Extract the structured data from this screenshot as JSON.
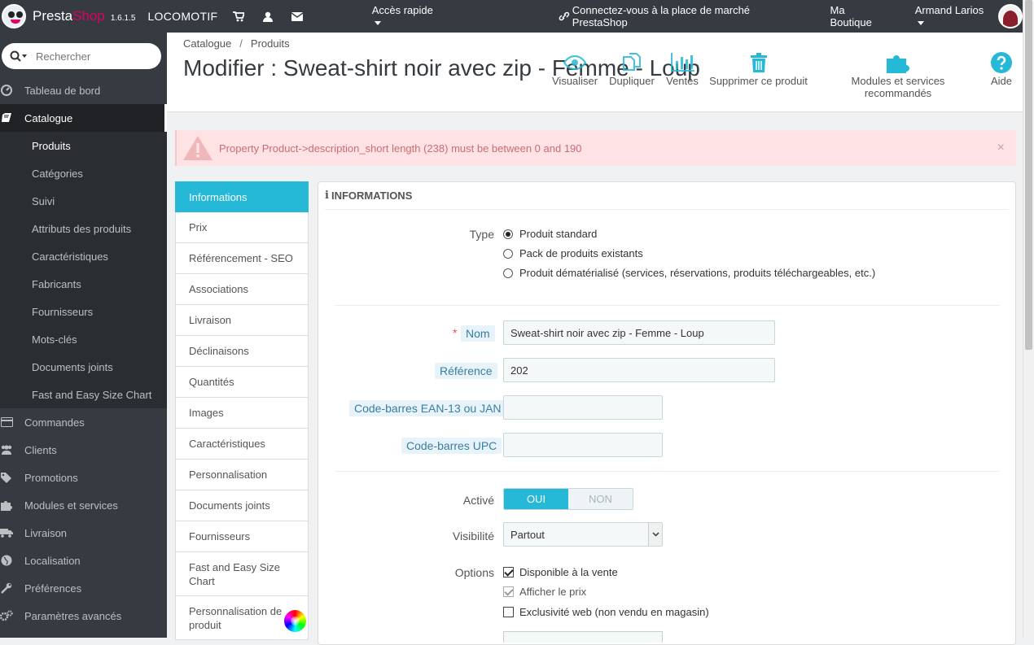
{
  "topbar": {
    "logo_presta": "Presta",
    "logo_shop": "Shop",
    "version": "1.6.1.5",
    "shop_name": "LOCOMOTIF",
    "quick_access": "Accès rapide",
    "marketplace": "Connectez-vous à la place de marché PrestaShop",
    "my_shop": "Ma Boutique",
    "user": "Armand Larios"
  },
  "sidebar": {
    "search_placeholder": "Rechercher",
    "items": [
      {
        "label": "Tableau de bord",
        "icon": "dashboard-icon"
      },
      {
        "label": "Catalogue",
        "icon": "book-icon"
      },
      {
        "label": "Commandes",
        "icon": "credit-card-icon"
      },
      {
        "label": "Clients",
        "icon": "users-icon"
      },
      {
        "label": "Promotions",
        "icon": "tags-icon"
      },
      {
        "label": "Modules et services",
        "icon": "puzzle-icon"
      },
      {
        "label": "Livraison",
        "icon": "truck-icon"
      },
      {
        "label": "Localisation",
        "icon": "globe-icon"
      },
      {
        "label": "Préférences",
        "icon": "wrench-icon"
      },
      {
        "label": "Paramètres avancés",
        "icon": "cogs-icon"
      }
    ],
    "catalogue_sub": [
      "Produits",
      "Catégories",
      "Suivi",
      "Attributs des produits",
      "Caractéristiques",
      "Fabricants",
      "Fournisseurs",
      "Mots-clés",
      "Documents joints",
      "Fast and Easy Size Chart"
    ]
  },
  "header": {
    "breadcrumb": [
      "Catalogue",
      "Produits"
    ],
    "title": "Modifier : Sweat-shirt noir avec zip - Femme - Loup",
    "toolbar": {
      "view": "Visualiser",
      "duplicate": "Dupliquer",
      "sales": "Ventes",
      "delete": "Supprimer ce produit",
      "modules": "Modules et services recommandés",
      "help": "Aide"
    }
  },
  "alert": {
    "message": "Property Product->description_short length (238) must be between 0 and 190",
    "close": "×"
  },
  "tabs": [
    "Informations",
    "Prix",
    "Référencement - SEO",
    "Associations",
    "Livraison",
    "Déclinaisons",
    "Quantités",
    "Images",
    "Caractéristiques",
    "Personnalisation",
    "Documents joints",
    "Fournisseurs",
    "Fast and Easy Size Chart",
    "Personnalisation de produit"
  ],
  "panel": {
    "heading": "INFORMATIONS",
    "type_label": "Type",
    "type_options": [
      "Produit standard",
      "Pack de produits existants",
      "Produit dématérialisé (services, réservations, produits téléchargeables, etc.)"
    ],
    "required_mark": "*",
    "name_label": "Nom",
    "name_value": "Sweat-shirt noir avec zip - Femme - Loup",
    "reference_label": "Référence",
    "reference_value": "202",
    "ean_label": "Code-barres EAN-13 ou JAN",
    "ean_value": "",
    "upc_label": "Code-barres UPC",
    "upc_value": "",
    "active_label": "Activé",
    "active_on": "OUI",
    "active_off": "NON",
    "visibility_label": "Visibilité",
    "visibility_value": "Partout",
    "options_label": "Options",
    "options": [
      {
        "label": "Disponible à la vente",
        "checked": true
      },
      {
        "label": "Afficher le prix",
        "checked": true
      },
      {
        "label": "Exclusivité web (non vendu en magasin)",
        "checked": false
      }
    ]
  }
}
